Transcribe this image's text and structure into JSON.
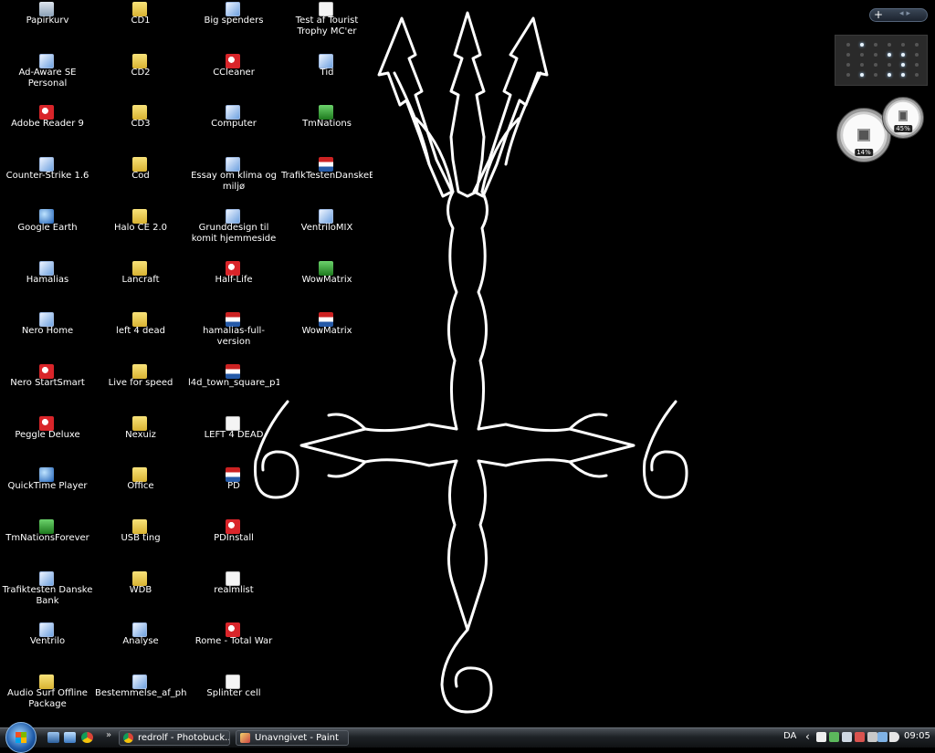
{
  "desktop": {
    "columns": [
      [
        {
          "label": "Papirkurv",
          "icon": "recycle-bin-icon",
          "kind": "g-trash"
        },
        {
          "label": "Ad-Aware SE Personal",
          "icon": "ad-aware-icon",
          "kind": "g-app"
        },
        {
          "label": "Adobe Reader 9",
          "icon": "adobe-reader-icon",
          "kind": "g-red"
        },
        {
          "label": "Counter-Strike 1.6",
          "icon": "counter-strike-icon",
          "kind": "g-app"
        },
        {
          "label": "Google Earth",
          "icon": "google-earth-icon",
          "kind": "g-globe"
        },
        {
          "label": "Hamalias",
          "icon": "hamalias-icon",
          "kind": "g-app"
        },
        {
          "label": "Nero Home",
          "icon": "nero-home-icon",
          "kind": "g-app"
        },
        {
          "label": "Nero StartSmart",
          "icon": "nero-startsmart-icon",
          "kind": "g-red"
        },
        {
          "label": "Peggle Deluxe",
          "icon": "peggle-icon",
          "kind": "g-red"
        },
        {
          "label": "QuickTime Player",
          "icon": "quicktime-icon",
          "kind": "g-globe"
        },
        {
          "label": "TmNationsForever",
          "icon": "tmnations-forever-icon",
          "kind": "g-green"
        },
        {
          "label": "Trafiktesten Danske Bank",
          "icon": "trafiktesten-icon",
          "kind": "g-app"
        },
        {
          "label": "Ventrilo",
          "icon": "ventrilo-icon",
          "kind": "g-app"
        },
        {
          "label": "Audio Surf Offline Package",
          "icon": "folder-icon",
          "kind": "g-folder"
        }
      ],
      [
        {
          "label": "CD1",
          "icon": "folder-icon",
          "kind": "g-folder"
        },
        {
          "label": "CD2",
          "icon": "folder-icon",
          "kind": "g-folder"
        },
        {
          "label": "CD3",
          "icon": "folder-icon",
          "kind": "g-folder"
        },
        {
          "label": "Cod",
          "icon": "folder-icon",
          "kind": "g-folder"
        },
        {
          "label": "Halo CE 2.0",
          "icon": "folder-icon",
          "kind": "g-folder"
        },
        {
          "label": "Lancraft",
          "icon": "folder-icon",
          "kind": "g-folder"
        },
        {
          "label": "left 4 dead",
          "icon": "folder-icon",
          "kind": "g-folder"
        },
        {
          "label": "Live for speed",
          "icon": "folder-icon",
          "kind": "g-folder"
        },
        {
          "label": "Nexuiz",
          "icon": "folder-icon",
          "kind": "g-folder"
        },
        {
          "label": "Office",
          "icon": "folder-icon",
          "kind": "g-folder"
        },
        {
          "label": "USB ting",
          "icon": "folder-icon",
          "kind": "g-folder"
        },
        {
          "label": "WDB",
          "icon": "folder-icon",
          "kind": "g-folder"
        },
        {
          "label": "Analyse",
          "icon": "document-icon",
          "kind": "g-app"
        },
        {
          "label": "Bestemmelse_af_pho...",
          "icon": "document-icon",
          "kind": "g-app"
        }
      ],
      [
        {
          "label": "Big spenders",
          "icon": "document-icon",
          "kind": "g-app"
        },
        {
          "label": "CCleaner",
          "icon": "ccleaner-icon",
          "kind": "g-red"
        },
        {
          "label": "Computer",
          "icon": "computer-icon",
          "kind": "g-app"
        },
        {
          "label": "Essay om klima og miljø",
          "icon": "document-icon",
          "kind": "g-app"
        },
        {
          "label": "Grunddesign til komit hjemmeside",
          "icon": "document-icon",
          "kind": "g-app"
        },
        {
          "label": "Half-Life",
          "icon": "half-life-icon",
          "kind": "g-red"
        },
        {
          "label": "hamalias-full-version",
          "icon": "archive-icon",
          "kind": "g-flag"
        },
        {
          "label": "l4d_town_square_p1",
          "icon": "archive-icon",
          "kind": "g-flag"
        },
        {
          "label": "LEFT 4 DEAD",
          "icon": "left4dead-icon",
          "kind": "g-doc"
        },
        {
          "label": "PD",
          "icon": "archive-icon",
          "kind": "g-flag"
        },
        {
          "label": "PDInstall",
          "icon": "pdinstall-icon",
          "kind": "g-red"
        },
        {
          "label": "realmlist",
          "icon": "text-file-icon",
          "kind": "g-doc"
        },
        {
          "label": "Rome - Total War",
          "icon": "rome-total-war-icon",
          "kind": "g-red"
        },
        {
          "label": "Splinter cell",
          "icon": "splinter-cell-icon",
          "kind": "g-doc"
        }
      ],
      [
        {
          "label": "Test af Tourist Trophy MC'er",
          "icon": "document-icon",
          "kind": "g-doc"
        },
        {
          "label": "Tid",
          "icon": "document-icon",
          "kind": "g-app"
        },
        {
          "label": "TmNations",
          "icon": "tmnations-icon",
          "kind": "g-green"
        },
        {
          "label": "TrafikTestenDanskeB...",
          "icon": "archive-icon",
          "kind": "g-flag"
        },
        {
          "label": "VentriloMIX",
          "icon": "ventrilomix-icon",
          "kind": "g-app"
        },
        {
          "label": "WowMatrix",
          "icon": "wowmatrix-icon",
          "kind": "g-green"
        },
        {
          "label": "WowMatrix",
          "icon": "archive-icon",
          "kind": "g-flag"
        }
      ]
    ]
  },
  "sidebar": {
    "add_symbol": "+",
    "nav_arrows": "◂▸",
    "cpu_gauge": {
      "value_label": "14%",
      "value": 14
    },
    "memory_gauge": {
      "value_label": "45%",
      "value": 45
    }
  },
  "taskbar": {
    "more_quicklaunch": "»",
    "tasks": [
      {
        "label": "redrolf - Photobuck...",
        "icon": "chrome-icon"
      },
      {
        "label": "Unavngivet - Paint",
        "icon": "paint-icon"
      }
    ],
    "language": "DA",
    "show_hidden": "‹",
    "clock": "09:05"
  },
  "colors": {
    "desktop_bg": "#000000",
    "wallpaper_stroke": "#ffffff",
    "taskbar_top": "#4b5158",
    "taskbar_bottom": "#101214"
  }
}
